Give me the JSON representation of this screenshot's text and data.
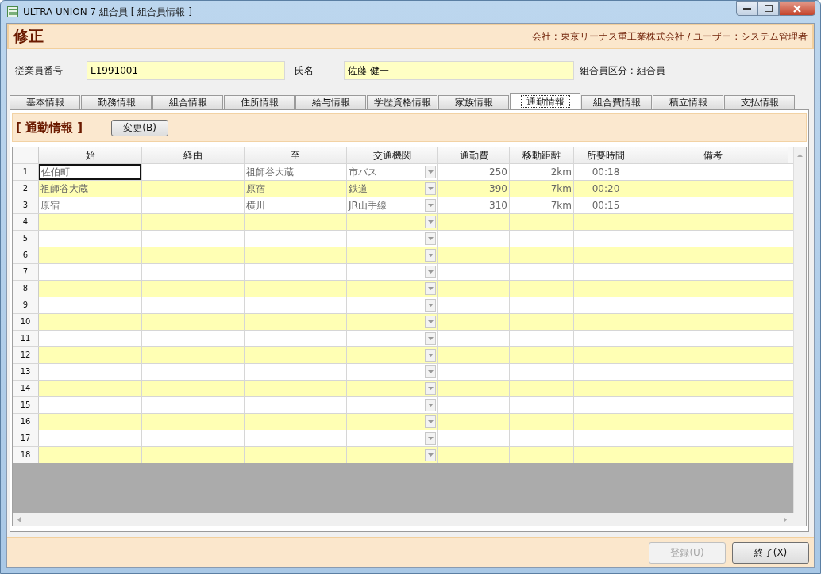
{
  "window": {
    "title": "ULTRA UNION 7 組合員 [ 組合員情報 ]"
  },
  "header": {
    "mode": "修正",
    "info": "会社 : 東京リーナス重工業株式会社 / ユーザー : システム管理者"
  },
  "fields": {
    "employee_number": {
      "label": "従業員番号",
      "value": "L1991001"
    },
    "name": {
      "label": "氏名",
      "value": "佐藤 健一"
    },
    "member_class": "組合員区分 : 組合員"
  },
  "tabs": [
    {
      "label": "基本情報",
      "selected": false
    },
    {
      "label": "勤務情報",
      "selected": false
    },
    {
      "label": "組合情報",
      "selected": false
    },
    {
      "label": "住所情報",
      "selected": false
    },
    {
      "label": "給与情報",
      "selected": false
    },
    {
      "label": "学歴資格情報",
      "selected": false
    },
    {
      "label": "家族情報",
      "selected": false
    },
    {
      "label": "通勤情報",
      "selected": true
    },
    {
      "label": "組合費情報",
      "selected": false
    },
    {
      "label": "積立情報",
      "selected": false
    },
    {
      "label": "支払情報",
      "selected": false
    }
  ],
  "section": {
    "title": "[ 通勤情報 ]",
    "change_button": "変更(B)"
  },
  "table": {
    "columns": [
      {
        "label": "始",
        "kind": "text"
      },
      {
        "label": "経由",
        "kind": "text"
      },
      {
        "label": "至",
        "kind": "text"
      },
      {
        "label": "交通機関",
        "kind": "dropdown"
      },
      {
        "label": "通勤費",
        "kind": "number"
      },
      {
        "label": "移動距離",
        "kind": "number"
      },
      {
        "label": "所要時間",
        "kind": "center"
      },
      {
        "label": "備考",
        "kind": "text"
      }
    ],
    "rows": [
      {
        "number": "1",
        "focused": true,
        "cells": [
          "佐伯町",
          null,
          "祖師谷大蔵",
          "市バス",
          "250",
          "2km",
          "00:18",
          null
        ]
      },
      {
        "number": "2",
        "focused": false,
        "cells": [
          "祖師谷大蔵",
          null,
          "原宿",
          "鉄道",
          "390",
          "7km",
          "00:20",
          null
        ]
      },
      {
        "number": "3",
        "focused": false,
        "cells": [
          "原宿",
          null,
          "横川",
          "JR山手線",
          "310",
          "7km",
          "00:15",
          null
        ]
      },
      {
        "number": "4",
        "focused": false
      },
      {
        "number": "5",
        "focused": false
      },
      {
        "number": "6",
        "focused": false
      },
      {
        "number": "7",
        "focused": false
      },
      {
        "number": "8",
        "focused": false
      },
      {
        "number": "9",
        "focused": false
      },
      {
        "number": "10",
        "focused": false
      },
      {
        "number": "11",
        "focused": false
      },
      {
        "number": "12",
        "focused": false
      },
      {
        "number": "13",
        "focused": false
      },
      {
        "number": "14",
        "focused": false
      },
      {
        "number": "15",
        "focused": false
      },
      {
        "number": "16",
        "focused": false
      },
      {
        "number": "17",
        "focused": false
      },
      {
        "number": "18",
        "focused": false
      }
    ]
  },
  "buttons": [
    {
      "label": "登録(U)",
      "disabled": true
    },
    {
      "label": "終了(X)",
      "disabled": false
    }
  ]
}
